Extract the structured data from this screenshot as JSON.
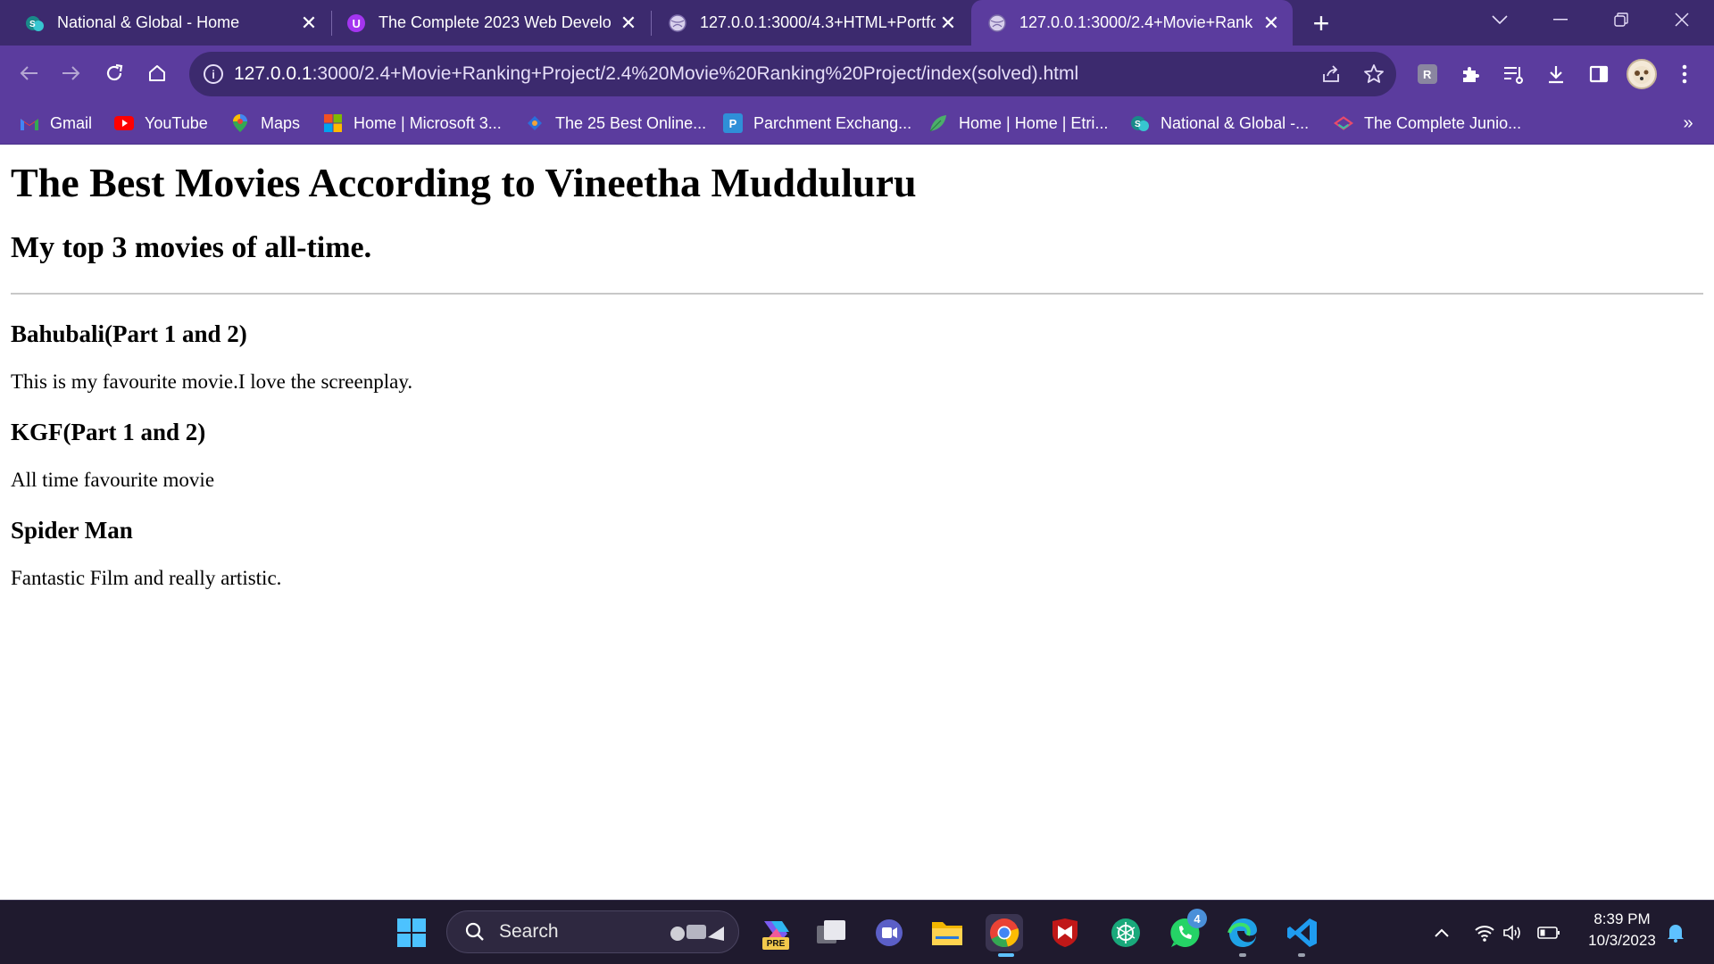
{
  "tabs": [
    {
      "title": "National & Global - Home",
      "icon": "sharepoint-icon"
    },
    {
      "title": "The Complete 2023 Web Develo",
      "icon": "udemy-icon"
    },
    {
      "title": "127.0.0.1:3000/4.3+HTML+Portfo",
      "icon": "globe-icon"
    },
    {
      "title": "127.0.0.1:3000/2.4+Movie+Rank",
      "icon": "globe-icon",
      "active": true
    }
  ],
  "address": {
    "host": "127.0.0.1",
    "path": ":3000/2.4+Movie+Ranking+Project/2.4%20Movie%20Ranking%20Project/index(solved).html"
  },
  "bookmarks": [
    {
      "label": "Gmail",
      "icon": "gmail-icon"
    },
    {
      "label": "YouTube",
      "icon": "youtube-icon"
    },
    {
      "label": "Maps",
      "icon": "maps-icon"
    },
    {
      "label": "Home | Microsoft 3...",
      "icon": "microsoft-icon"
    },
    {
      "label": "The 25 Best Online...",
      "icon": "site-icon"
    },
    {
      "label": "Parchment Exchang...",
      "icon": "parchment-icon"
    },
    {
      "label": "Home | Home | Etri...",
      "icon": "leaf-icon"
    },
    {
      "label": "National & Global -...",
      "icon": "sharepoint-icon"
    },
    {
      "label": "The Complete Junio...",
      "icon": "course-icon"
    }
  ],
  "page": {
    "title": "The Best Movies According to Vineetha Mudduluru",
    "subtitle": "My top 3 movies of all-time.",
    "movies": [
      {
        "name": "Bahubali(Part 1 and 2)",
        "description": "This is my favourite movie.I love the screenplay."
      },
      {
        "name": "KGF(Part 1 and 2)",
        "description": "All time favourite movie"
      },
      {
        "name": "Spider Man",
        "description": "Fantastic Film and really artistic."
      }
    ]
  },
  "taskbar": {
    "search_label": "Search",
    "whatsapp_badge": "4",
    "time": "8:39 PM",
    "date": "10/3/2023",
    "pre_badge": "PRE"
  },
  "colors": {
    "tabstrip": "#3c2a6e",
    "toolbar": "#5b3c9e",
    "taskbar": "#1f1a2e"
  }
}
